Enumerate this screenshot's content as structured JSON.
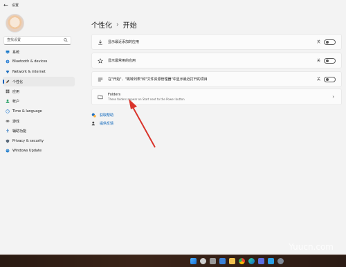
{
  "window": {
    "title": "设置"
  },
  "sidebar": {
    "search_placeholder": "查找设置",
    "items": [
      {
        "label": "系统",
        "icon": "system-icon"
      },
      {
        "label": "Bluetooth & devices",
        "icon": "bluetooth-icon"
      },
      {
        "label": "Network & internet",
        "icon": "network-icon"
      },
      {
        "label": "个性化",
        "icon": "brush-icon",
        "active": true
      },
      {
        "label": "应用",
        "icon": "apps-icon"
      },
      {
        "label": "帐户",
        "icon": "account-icon"
      },
      {
        "label": "Time & language",
        "icon": "globe-clock-icon"
      },
      {
        "label": "游戏",
        "icon": "gamepad-icon"
      },
      {
        "label": "辅助功能",
        "icon": "accessibility-icon"
      },
      {
        "label": "Privacy & security",
        "icon": "shield-icon"
      },
      {
        "label": "Windows Update",
        "icon": "update-icon"
      }
    ]
  },
  "main": {
    "breadcrumb": {
      "parent": "个性化",
      "separator": "›",
      "current": "开始"
    },
    "settings": [
      {
        "label": "显示最近添加的应用",
        "toggle_text": "关",
        "icon": "download-icon"
      },
      {
        "label": "显示最常用的应用",
        "toggle_text": "关",
        "icon": "star-icon"
      },
      {
        "label": "在\"开始\"、\"跳转列表\"和\"文件资源管理器\"中显示最近打开的项目",
        "toggle_text": "关",
        "icon": "list-icon"
      }
    ],
    "folders": {
      "title": "Folders",
      "subtitle": "These folders appear on Start next to the Power button",
      "chevron": "›"
    },
    "links": [
      {
        "label": "获取帮助",
        "icon": "help-icon"
      },
      {
        "label": "提供反馈",
        "icon": "feedback-icon"
      }
    ]
  },
  "watermark": "Yuucn.com",
  "colors": {
    "accent": "#005fb8",
    "arrow": "#d9342b",
    "background": "#f3f3f3"
  }
}
